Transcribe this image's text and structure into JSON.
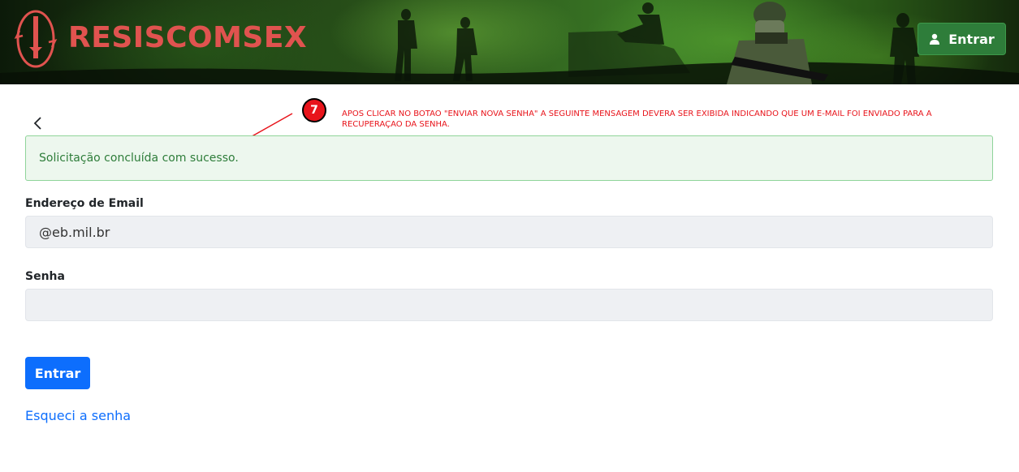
{
  "header": {
    "brand": "RESISCOMSEX",
    "login_label": "Entrar"
  },
  "annotation": {
    "step": "7",
    "text": "APOS CLICAR NO BOTAO \"ENVIAR NOVA SENHA\" A SEGUINTE MENSAGEM DEVERA SER EXIBIDA INDICANDO QUE UM E-MAIL FOI ENVIADO PARA A RECUPERAÇAO DA SENHA."
  },
  "alert": {
    "message": "Solicitação concluída com sucesso."
  },
  "form": {
    "email_label": "Endereço de Email",
    "email_value": "@eb.mil.br",
    "password_label": "Senha",
    "password_value": "",
    "submit_label": "Entrar",
    "forgot_label": "Esqueci a senha"
  },
  "colors": {
    "brand": "#e0534f",
    "primary": "#0d6efd",
    "success": "#2e7d3a",
    "annotation": "#e8141b"
  },
  "icons": {
    "back": "chevron-left-icon",
    "user": "user-icon",
    "emblem": "logo-emblem"
  }
}
